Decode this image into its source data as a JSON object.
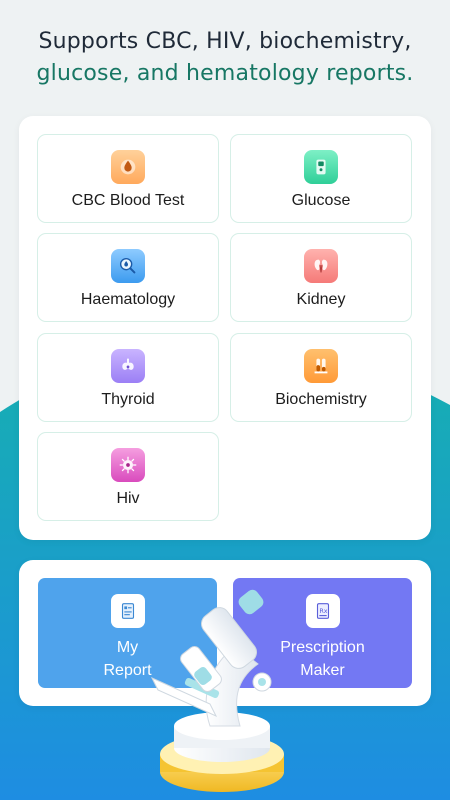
{
  "headline": {
    "line1": "Supports CBC, HIV, biochemistry,",
    "line2": "glucose, and hematology reports."
  },
  "report_types": [
    {
      "label": "CBC Blood Test",
      "icon": "blood-drop-icon",
      "color": "#ffb26b"
    },
    {
      "label": "Glucose",
      "icon": "glucose-meter-icon",
      "color": "#43d6a4"
    },
    {
      "label": "Haematology",
      "icon": "magnifier-drop-icon",
      "color": "#4aa8f0"
    },
    {
      "label": "Kidney",
      "icon": "kidney-icon",
      "color": "#fb8787"
    },
    {
      "label": "Thyroid",
      "icon": "thyroid-icon",
      "color": "#a78bfa"
    },
    {
      "label": "Biochemistry",
      "icon": "test-tube-icon",
      "color": "#ffa24a"
    },
    {
      "label": "Hiv",
      "icon": "virus-icon",
      "color": "#e463c8"
    }
  ],
  "actions": {
    "my_report": {
      "line1": "My",
      "line2": "Report",
      "color": "#4fa3ec",
      "icon": "report-icon"
    },
    "prescription": {
      "line1": "Prescription",
      "line2": "Maker",
      "color": "#7378f3",
      "icon": "prescription-icon"
    }
  },
  "colors": {
    "accent": "#177764",
    "wave_top": "#19a8b4",
    "wave_bottom": "#1c8fe0"
  }
}
